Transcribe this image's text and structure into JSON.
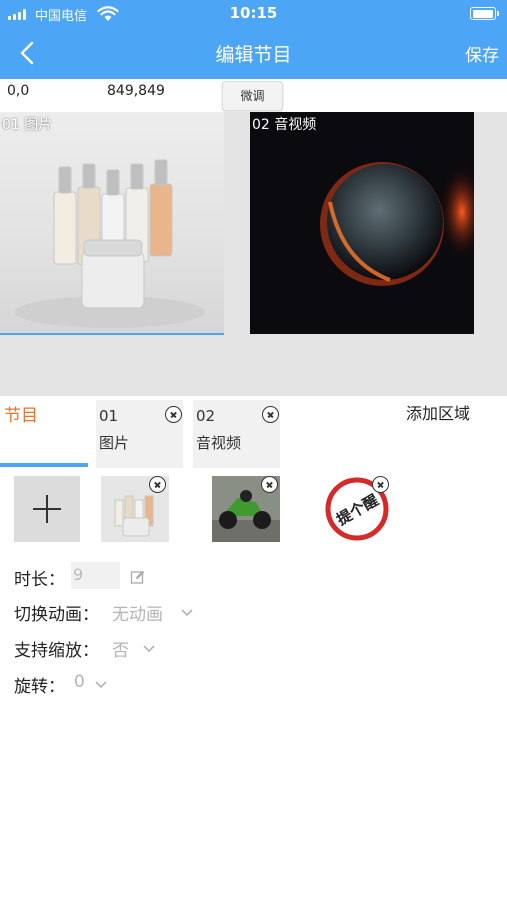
{
  "status_bar": {
    "carrier": "中国电信",
    "time": "10:15"
  },
  "nav": {
    "title": "编辑节目",
    "save_label": "保存",
    "back_icon": "chevron-left-icon"
  },
  "coords": {
    "origin": "0,0",
    "size": "849,849",
    "fine_tune_label": "微调"
  },
  "canvas": {
    "regions": [
      {
        "label": "01 图片"
      },
      {
        "label": "02 音视频"
      }
    ]
  },
  "tabs": {
    "main_label": "节目",
    "cards": [
      {
        "num": "01",
        "name": "图片"
      },
      {
        "num": "02",
        "name": "音视频"
      }
    ],
    "add_area_label": "添加区域"
  },
  "media": {
    "add_icon": "plus-icon",
    "reminder_text": "提个醒"
  },
  "properties": {
    "duration_label": "时长：",
    "duration_value": "9",
    "transition_label": "切换动画：",
    "transition_value": "无动画",
    "zoom_label": "支持缩放：",
    "zoom_value": "否",
    "rotate_label": "旋转：",
    "rotate_value": "0"
  },
  "colors": {
    "accent": "#4da6f5",
    "tab_active": "#e8732e"
  }
}
